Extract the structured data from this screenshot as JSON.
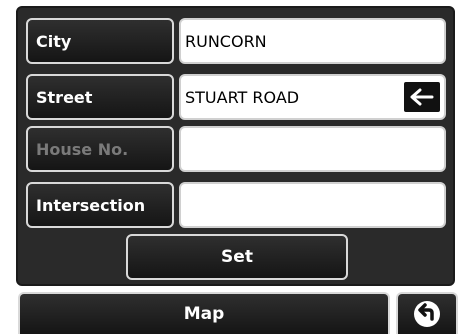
{
  "form": {
    "city_label": "City",
    "city_value": "RUNCORN",
    "street_label": "Street",
    "street_value": "STUART ROAD",
    "house_label": "House No.",
    "house_value": "",
    "intersection_label": "Intersection",
    "intersection_value": ""
  },
  "buttons": {
    "set_label": "Set",
    "map_label": "Map"
  },
  "icons": {
    "street_clear": "left-arrow-icon",
    "back": "back-arrow-circle-icon"
  }
}
